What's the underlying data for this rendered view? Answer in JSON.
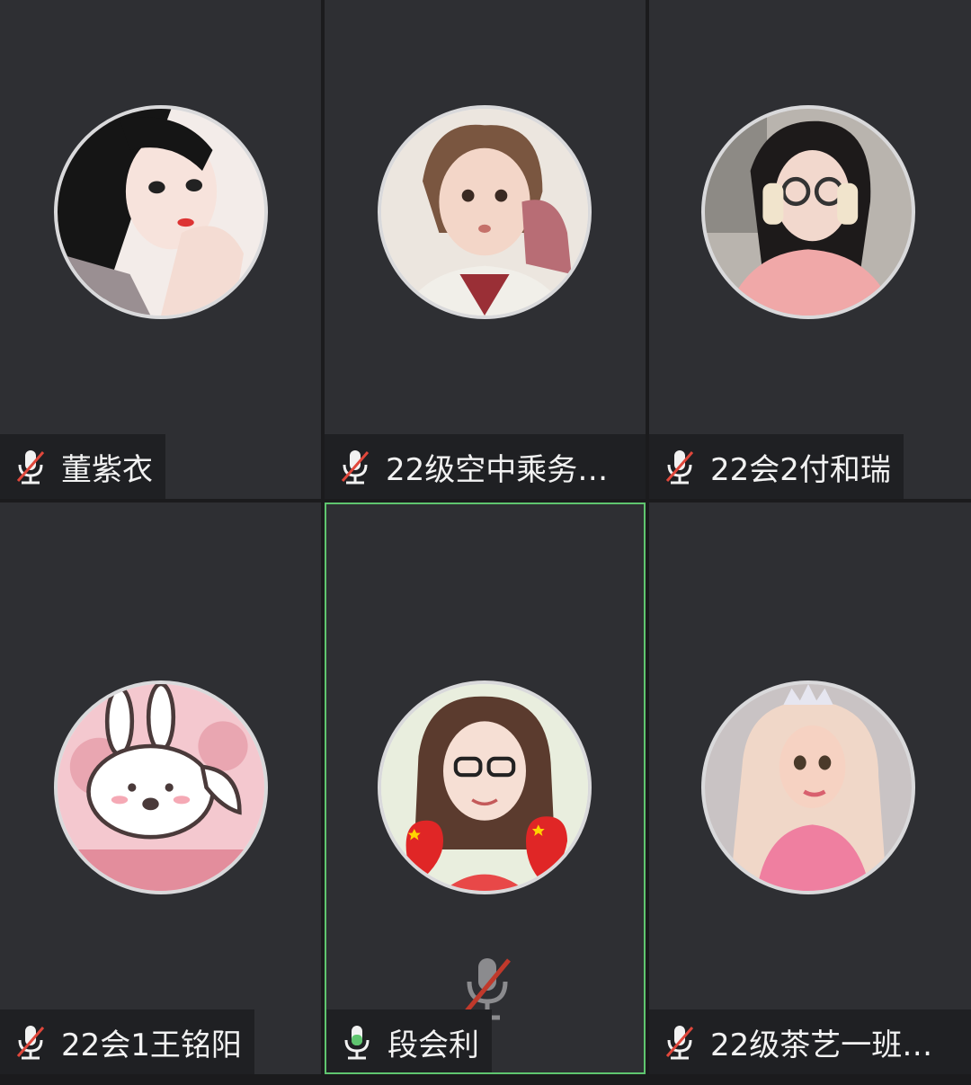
{
  "participants": [
    {
      "name": "董紫衣",
      "muted": true,
      "avatar": "girl-illustration-hand-on-chin"
    },
    {
      "name": "22级空中乘务…",
      "muted": true,
      "avatar": "child-photo-pink-sweater"
    },
    {
      "name": "22会2付和瑞",
      "muted": true,
      "avatar": "girl-photo-glasses"
    },
    {
      "name": "22会1王铭阳",
      "muted": true,
      "avatar": "bunny-cartoon-pink"
    },
    {
      "name": "段会利",
      "muted": false,
      "speaking": true,
      "avatar": "woman-glasses-hearts-flags"
    },
    {
      "name": "22级茶艺一班…",
      "muted": true,
      "avatar": "princess-doll-pink-hair"
    }
  ],
  "colors": {
    "tile_bg": "#2e2f33",
    "namebar_bg": "#1f2023",
    "active_border": "#5fc56f",
    "muted_slash": "#e0473b",
    "mic_active": "#5fc56f"
  }
}
